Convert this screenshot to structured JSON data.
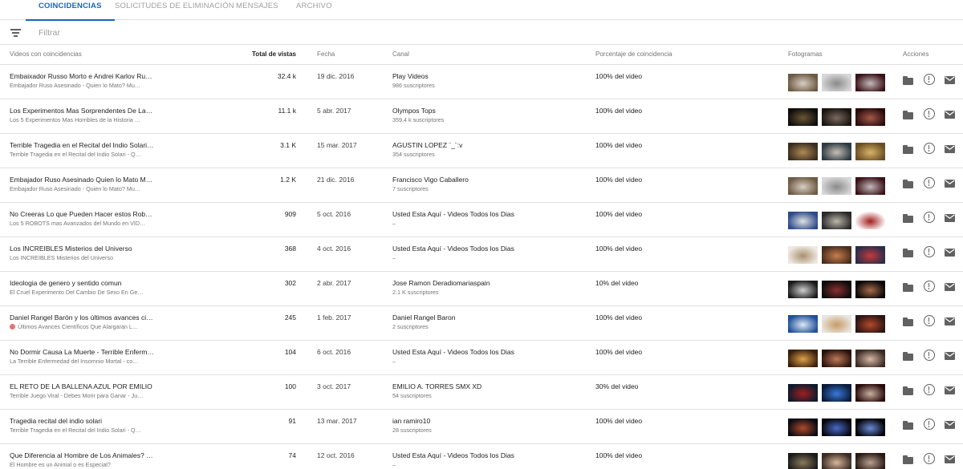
{
  "tabs": [
    "COINCIDENCIAS",
    "SOLICITUDES DE ELIMINACIÓN",
    "MENSAJES",
    "ARCHIVO"
  ],
  "active_tab": 0,
  "filter": {
    "placeholder": "Filtrar",
    "value": ""
  },
  "columns": {
    "video": "Videos con coincidencias",
    "views": "Total de vistas",
    "date": "Fecha",
    "channel": "Canal",
    "percent": "Porcentaje de coincidencia",
    "frames": "Fotogramas",
    "actions": "Acciones"
  },
  "rows": [
    {
      "title": "Embaixador Russo Morto e Andrei Karlov Rusi…",
      "subtitle": "Embajador Ruso Asesinado - Quien lo Mato? Mu…",
      "views": "32.4 k",
      "date": "19 dic. 2016",
      "channel": "Play Videos",
      "subscribers": "986 suscriptores",
      "percent": "100% del video",
      "frames": [
        [
          "#6d5a44",
          "#d9cfc2"
        ],
        [
          "#d7d7d7",
          "#8a8a8a"
        ],
        [
          "#3a1218",
          "#c4b9b9"
        ]
      ]
    },
    {
      "title": "Los Experimentos Mas Sorprendentes De La …",
      "subtitle": "Los 5 Experimentos Mas Horribles de la Historia …",
      "views": "11.1 k",
      "date": "5 abr. 2017",
      "channel": "Olympos Tops",
      "subscribers": "359.4 k suscriptores",
      "percent": "100% del video",
      "frames": [
        [
          "#0d0d0d",
          "#6b5633"
        ],
        [
          "#1a1410",
          "#7a6a60"
        ],
        [
          "#2a0b0b",
          "#a35a4a"
        ]
      ]
    },
    {
      "title": "Terrible Tragedia en el Recital del Indio Solari …",
      "subtitle": "Terrible Tragedia en el Recital del Indio Solari - Q…",
      "views": "3.1 K",
      "date": "15 mar. 2017",
      "channel": "AGUSTIN LOPEZ ¨_¨:v",
      "subscribers": "354 suscriptores",
      "percent": "100% del video",
      "frames": [
        [
          "#3b2e1f",
          "#b08a56"
        ],
        [
          "#2d3a44",
          "#c7c1b4"
        ],
        [
          "#6b4e22",
          "#d8b46a"
        ]
      ]
    },
    {
      "title": "Embajador Ruso Asesinado Quien lo Mato Mu…",
      "subtitle": "Embajador Ruso Asesinado - Quien lo Mato? Mu…",
      "views": "1.2 K",
      "date": "21 dic. 2016",
      "channel": "Francisco Vigo Caballero",
      "subscribers": "7 suscriptores",
      "percent": "100% del video",
      "frames": [
        [
          "#6d5a44",
          "#d9cfc2"
        ],
        [
          "#d7d7d7",
          "#8a8a8a"
        ],
        [
          "#3a1218",
          "#c4b9b9"
        ]
      ]
    },
    {
      "title": "No Creeras Lo que Pueden Hacer estos Robot…",
      "subtitle": "Los 5 ROBOTS mas Avanzados del Mundo en VID…",
      "views": "909",
      "date": "5 oct. 2016",
      "channel": "Usted Esta Aquí - Videos Todos los Dias",
      "subscribers": "–",
      "percent": "100% del video",
      "frames": [
        [
          "#2c4a8a",
          "#e2e2e2"
        ],
        [
          "#2a2a2a",
          "#bdb6aa"
        ],
        [
          "#ffffff",
          "#a31d1d"
        ]
      ]
    },
    {
      "title": "Los INCREIBLES Misterios del Universo",
      "subtitle": "Los INCREIBLES Misterios del Universo",
      "views": "368",
      "date": "4 oct. 2016",
      "channel": "Usted Esta Aquí - Videos Todos los Dias",
      "subscribers": "–",
      "percent": "100% del video",
      "frames": [
        [
          "#efe9e1",
          "#a89070"
        ],
        [
          "#4a2d1d",
          "#c77e4f"
        ],
        [
          "#2a2d4a",
          "#c63a3a"
        ]
      ]
    },
    {
      "title": "Ideologia de genero y sentido comun",
      "subtitle": "El Cruel Experimento Del Cambio De Sexo En Ge…",
      "views": "302",
      "date": "2 abr. 2017",
      "channel": "Jose Ramon Deradiomariaspain",
      "subscribers": "2.1 K suscriptores",
      "percent": "10% del video",
      "frames": [
        [
          "#1a1a1a",
          "#d0d0d0"
        ],
        [
          "#0b0b0b",
          "#8a3030"
        ],
        [
          "#050505",
          "#a86b4a"
        ]
      ]
    },
    {
      "title": "Daniel Rangel Barón y los últimos avances cie…",
      "subtitle": "Últimos Avances Científicos Que Alargaran L…",
      "views": "245",
      "date": "1 feb. 2017",
      "channel": "Daniel Rangel Baron",
      "subscribers": "2 suscriptores",
      "percent": "100% del video",
      "frames": [
        [
          "#1e4f9a",
          "#dfe8f5"
        ],
        [
          "#e8e4de",
          "#c79b66"
        ],
        [
          "#2b1414",
          "#b34a2a"
        ]
      ]
    },
    {
      "title": "No Dormir Causa La Muerte - Terrible Enferme…",
      "subtitle": "La Terrible Enfermedad del Insomnio Mortal - co…",
      "views": "104",
      "date": "6 oct. 2016",
      "channel": "Usted Esta Aquí - Videos Todos los Dias",
      "subscribers": "–",
      "percent": "100% del video",
      "frames": [
        [
          "#3a1f0d",
          "#e0a24a"
        ],
        [
          "#2b120c",
          "#c07a5a"
        ],
        [
          "#3a2a22",
          "#d8b8a8"
        ]
      ]
    },
    {
      "title": "EL RETO DE LA BALLENA AZUL POR EMILIO",
      "subtitle": "Terrible Juego Viral - Debes Morir para Ganar - Ju…",
      "views": "100",
      "date": "3 oct. 2017",
      "channel": "EMILIO A. TORRES SMX XD",
      "subscribers": "54 suscriptores",
      "percent": "30% del video",
      "frames": [
        [
          "#0d1a2d",
          "#a02020"
        ],
        [
          "#0a1a3a",
          "#3a7ad8"
        ],
        [
          "#2a0a0a",
          "#c8b0a0"
        ]
      ]
    },
    {
      "title": "Tragedia recital del indio solari",
      "subtitle": "Terrible Tragedia en el Recital del Indio Solari - Q…",
      "views": "91",
      "date": "13 mar. 2017",
      "channel": "ian ramiro10",
      "subscribers": "28 suscriptores",
      "percent": "100% del video",
      "frames": [
        [
          "#0a0a14",
          "#b04a2a"
        ],
        [
          "#05050a",
          "#4a6ac8"
        ],
        [
          "#000000",
          "#6a8ad8"
        ]
      ]
    },
    {
      "title": "Que Diferencia al Hombre de Los Animales? …",
      "subtitle": "El Hombre es un Animal o es Especial?",
      "views": "74",
      "date": "12 oct. 2016",
      "channel": "Usted Esta Aquí - Videos Todos los Dias",
      "subscribers": "–",
      "percent": "100% del video",
      "frames": [
        [
          "#1a1a1a",
          "#8a7a5a"
        ],
        [
          "#3a2a22",
          "#d8b89a"
        ],
        [
          "#2a1a14",
          "#b8a090"
        ]
      ]
    }
  ]
}
